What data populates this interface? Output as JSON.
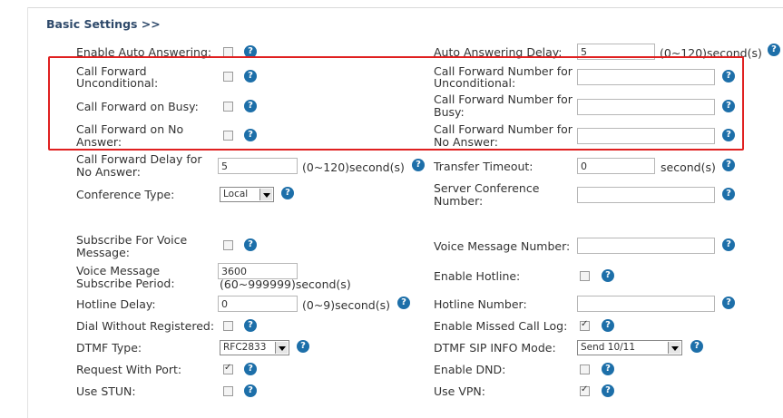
{
  "section_title": "Basic Settings >>",
  "help_glyph": "?",
  "colors": {
    "highlight_border": "#e02020",
    "help_icon": "#1d6fa9",
    "title": "#2f4a6b"
  },
  "rows": {
    "auto_answering": {
      "label": "Enable Auto Answering:",
      "checked": false
    },
    "auto_answering_delay": {
      "label": "Auto Answering Delay:",
      "value": "5",
      "unit": "(0~120)second(s)"
    },
    "cf_unconditional": {
      "label1": "Call Forward",
      "label2": "Unconditional:",
      "checked": false
    },
    "cf_unconditional_number": {
      "label1": "Call Forward Number for",
      "label2": "Unconditional:",
      "value": ""
    },
    "cf_busy": {
      "label": "Call Forward on Busy:",
      "checked": false
    },
    "cf_busy_number": {
      "label1": "Call Forward Number for",
      "label2": "Busy:",
      "value": ""
    },
    "cf_no_answer": {
      "label1": "Call Forward on No",
      "label2": "Answer:",
      "checked": false
    },
    "cf_no_answer_number": {
      "label1": "Call Forward Number for",
      "label2": "No Answer:",
      "value": ""
    },
    "cf_delay": {
      "label1": "Call Forward Delay for",
      "label2": "No Answer:",
      "value": "5",
      "unit": "(0~120)second(s)"
    },
    "transfer_timeout": {
      "label": "Transfer Timeout:",
      "value": "0",
      "unit": "second(s)"
    },
    "conference_type": {
      "label": "Conference Type:",
      "value": "Local"
    },
    "server_conference": {
      "label1": "Server Conference",
      "label2": "Number:",
      "value": ""
    },
    "subscribe_voice": {
      "label1": "Subscribe For Voice",
      "label2": "Message:",
      "checked": false
    },
    "voice_message_number": {
      "label": "Voice Message Number:",
      "value": ""
    },
    "vm_subscribe_period": {
      "label1": "Voice Message",
      "label2": "Subscribe Period:",
      "value": "3600",
      "unit": "(60~999999)second(s)"
    },
    "enable_hotline": {
      "label": "Enable Hotline:",
      "checked": false
    },
    "hotline_delay": {
      "label": "Hotline Delay:",
      "value": "0",
      "unit": "(0~9)second(s)"
    },
    "hotline_number": {
      "label": "Hotline Number:",
      "value": ""
    },
    "dial_without_registered": {
      "label": "Dial Without Registered:",
      "checked": false
    },
    "missed_call_log": {
      "label": "Enable Missed Call Log:",
      "checked": true
    },
    "dtmf_type": {
      "label": "DTMF Type:",
      "value": "RFC2833"
    },
    "dtmf_sip_info_mode": {
      "label": "DTMF SIP INFO Mode:",
      "value": "Send 10/11"
    },
    "request_with_port": {
      "label": "Request With Port:",
      "checked": true
    },
    "enable_dnd": {
      "label": "Enable DND:",
      "checked": false
    },
    "use_stun": {
      "label": "Use STUN:",
      "checked": false
    },
    "use_vpn": {
      "label": "Use VPN:",
      "checked": true
    }
  }
}
